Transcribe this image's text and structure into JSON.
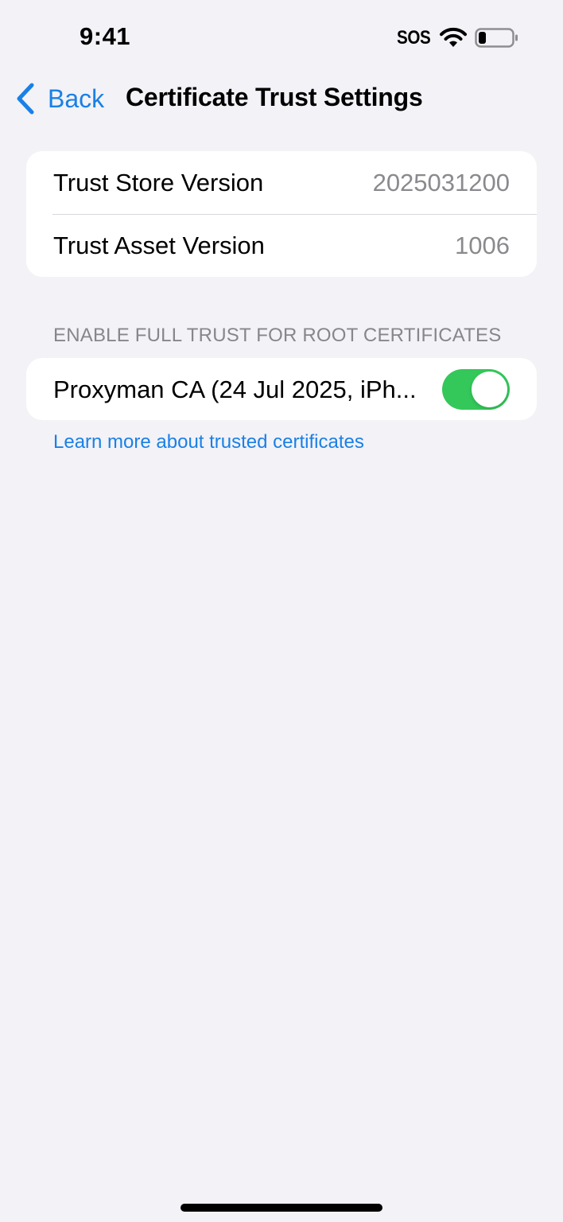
{
  "status_bar": {
    "time": "9:41",
    "carrier": "SOS",
    "wifi_icon": "wifi-icon",
    "battery_icon": "battery-low-icon"
  },
  "nav": {
    "back_label": "Back",
    "back_icon": "chevron-left-icon",
    "title": "Certificate Trust Settings"
  },
  "versions": [
    {
      "label": "Trust Store Version",
      "value": "2025031200"
    },
    {
      "label": "Trust Asset Version",
      "value": "1006"
    }
  ],
  "certificates": {
    "header": "ENABLE FULL TRUST FOR ROOT CERTIFICATES",
    "items": [
      {
        "label": "Proxyman CA (24 Jul 2025, iPh...",
        "enabled": true
      }
    ],
    "footer_link": "Learn more about trusted certificates"
  },
  "colors": {
    "accent": "#1a80e6",
    "toggle_on": "#34c759",
    "background": "#f2f2f7",
    "secondary_text": "#8a8a8e"
  }
}
